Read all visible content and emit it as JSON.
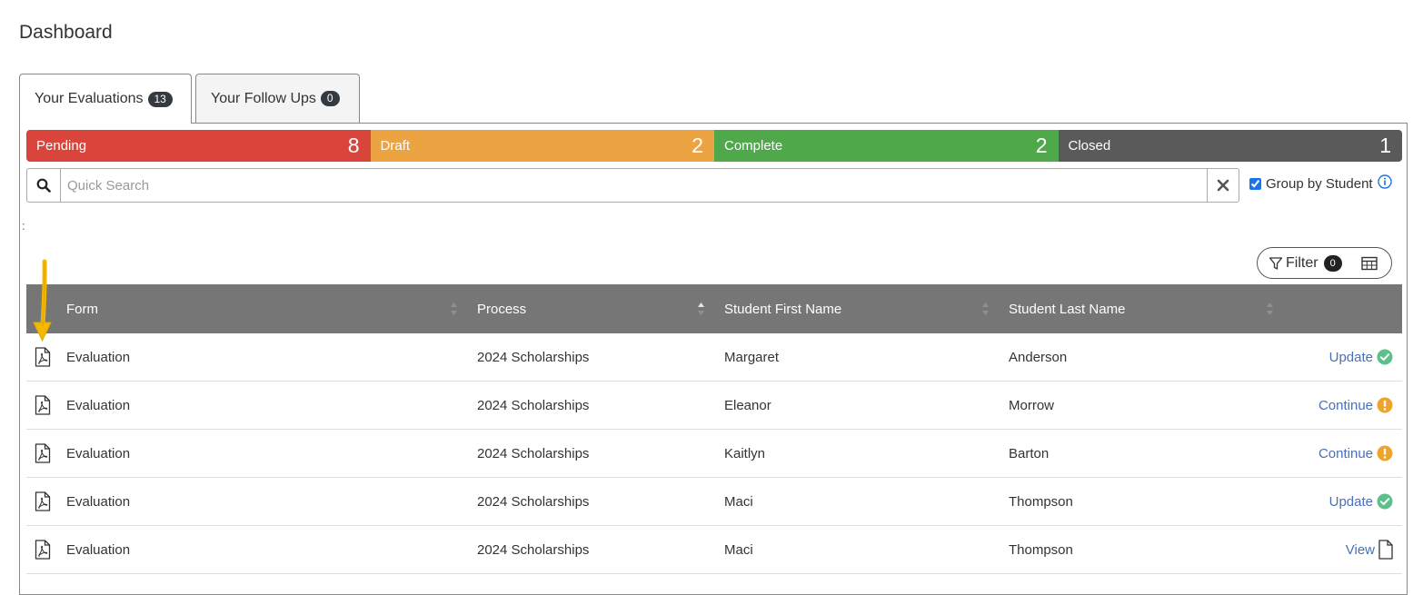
{
  "page": {
    "title": "Dashboard"
  },
  "tabs": [
    {
      "label": "Your Evaluations",
      "count": "13",
      "active": true
    },
    {
      "label": "Your Follow Ups",
      "count": "0",
      "active": false
    }
  ],
  "status": [
    {
      "label": "Pending",
      "count": "8",
      "color": "#d9453b"
    },
    {
      "label": "Draft",
      "count": "2",
      "color": "#eca443"
    },
    {
      "label": "Complete",
      "count": "2",
      "color": "#4fa84a"
    },
    {
      "label": "Closed",
      "count": "1",
      "color": "#5a5a5a"
    }
  ],
  "search": {
    "placeholder": "Quick Search",
    "value": "",
    "icon": "search-icon",
    "clear_icon": "close-icon"
  },
  "group_by": {
    "label": "Group by Student",
    "checked": true,
    "icon": "info-icon"
  },
  "stray_char": ":",
  "toolbar": {
    "filter_label": "Filter",
    "filter_count": "0",
    "filter_icon": "filter-icon",
    "columns_icon": "table-grid-icon"
  },
  "table": {
    "columns": [
      "Form",
      "Process",
      "Student First Name",
      "Student Last Name"
    ],
    "rows": [
      {
        "form": "Evaluation",
        "process": "2024 Scholarships",
        "first": "Margaret",
        "last": "Anderson",
        "action": "Update",
        "status_icon": "check-circle-icon"
      },
      {
        "form": "Evaluation",
        "process": "2024 Scholarships",
        "first": "Eleanor",
        "last": "Morrow",
        "action": "Continue",
        "status_icon": "exclamation-circle-icon"
      },
      {
        "form": "Evaluation",
        "process": "2024 Scholarships",
        "first": "Kaitlyn",
        "last": "Barton",
        "action": "Continue",
        "status_icon": "exclamation-circle-icon"
      },
      {
        "form": "Evaluation",
        "process": "2024 Scholarships",
        "first": "Maci",
        "last": "Thompson",
        "action": "Update",
        "status_icon": "check-circle-icon"
      },
      {
        "form": "Evaluation",
        "process": "2024 Scholarships",
        "first": "Maci",
        "last": "Thompson",
        "action": "View",
        "status_icon": "document-icon"
      }
    ]
  },
  "colors": {
    "header_bg": "#767676",
    "link": "#4a6fb8",
    "success": "#5cc08a",
    "warning": "#f0a32a",
    "annotation_arrow": "#f5b800"
  }
}
